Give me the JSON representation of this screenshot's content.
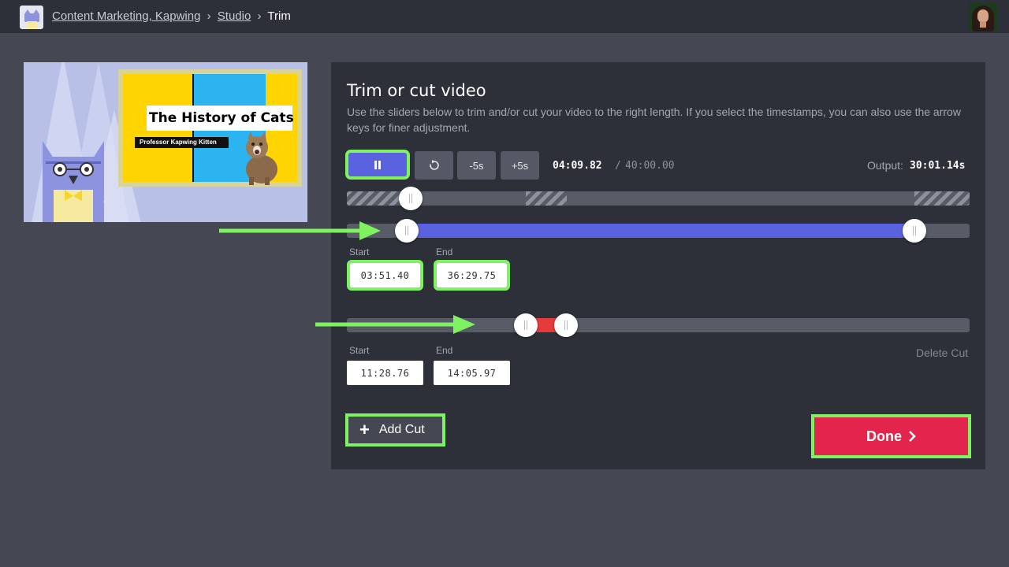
{
  "breadcrumb": {
    "workspace": "Content Marketing, Kapwing",
    "studio": "Studio",
    "current": "Trim",
    "separator": "›"
  },
  "preview": {
    "title": "The History of Cats",
    "subtitle": "Professor Kapwing Kitten"
  },
  "editor": {
    "title": "Trim or cut video",
    "description": "Use the sliders below to trim and/or cut your video to the right length. If you select the timestamps, you can also use the arrow keys for finer adjustment.",
    "controls": {
      "minus_label": "-5s",
      "plus_label": "+5s"
    },
    "current_time": "04:09.82",
    "time_separator": "/",
    "total_time": "40:00.00",
    "output_label": "Output:",
    "output_value": "30:01.14s",
    "trim": {
      "start_label": "Start",
      "end_label": "End",
      "start": "03:51.40",
      "end": "36:29.75"
    },
    "cut": {
      "start_label": "Start",
      "end_label": "End",
      "start": "11:28.76",
      "end": "14:05.97",
      "delete_label": "Delete Cut"
    },
    "add_cut_label": "Add Cut",
    "done_label": "Done"
  },
  "colors": {
    "trim_fill": "#5b62e0",
    "cut_fill": "#e53b3b",
    "highlight": "#7ef260",
    "done": "#e3254d"
  }
}
